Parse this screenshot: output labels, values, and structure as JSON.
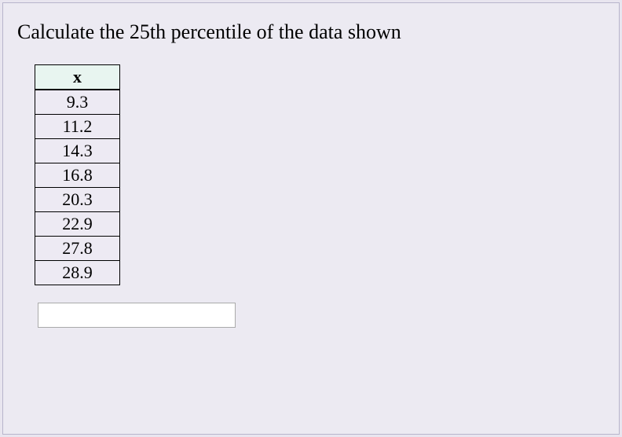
{
  "prompt": "Calculate the 25th percentile of the data shown",
  "table": {
    "header": "x",
    "values": [
      "9.3",
      "11.2",
      "14.3",
      "16.8",
      "20.3",
      "22.9",
      "27.8",
      "28.9"
    ]
  },
  "answer": {
    "value": "",
    "placeholder": ""
  },
  "chart_data": {
    "type": "table",
    "title": "Calculate the 25th percentile of the data shown",
    "columns": [
      "x"
    ],
    "rows": [
      [
        9.3
      ],
      [
        11.2
      ],
      [
        14.3
      ],
      [
        16.8
      ],
      [
        20.3
      ],
      [
        22.9
      ],
      [
        27.8
      ],
      [
        28.9
      ]
    ]
  }
}
